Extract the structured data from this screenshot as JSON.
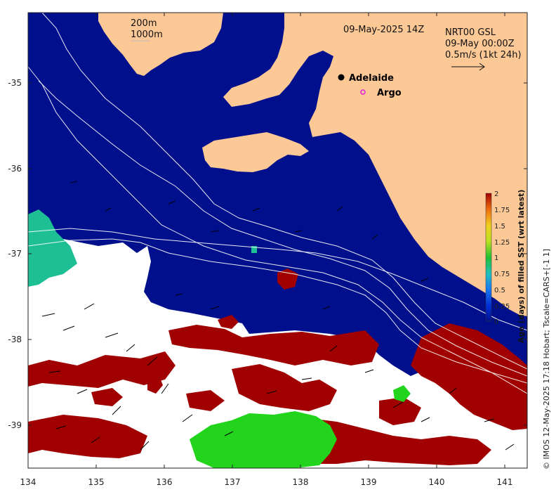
{
  "map": {
    "timestamp": "09-May-2025 14Z",
    "product": "NRT00 GSL",
    "product_time": "09-May 00:00Z",
    "vector_scale": "0.5m/s (1kt 24h)",
    "isobath_1": "200m",
    "isobath_2": "1000m",
    "credit": "© IMOS 12-May-2025 17:18 Hobart; Tscale=CARS+[-1 1]",
    "places": [
      {
        "name": "Adelaide",
        "marker": "filled-dot"
      },
      {
        "name": "Argo",
        "marker": "magenta-ring"
      }
    ],
    "colors": {
      "ocean_fresh": "#00108c",
      "land": "#fcc896",
      "stale_red": "#a00000",
      "green": "#22d41c",
      "teal": "#1fbf96",
      "no_data": "#ffffff"
    },
    "x_ticks": [
      "134",
      "135",
      "136",
      "137",
      "138",
      "139",
      "140",
      "141"
    ],
    "y_ticks": [
      "-35",
      "-36",
      "-37",
      "-38",
      "-39"
    ]
  },
  "colorbar": {
    "title": "Age (days) of filled SST (wrt latest)",
    "ticks": [
      "2",
      "1.75",
      "1.5",
      "1.25",
      "1",
      "0.75",
      "0.5",
      "0.25",
      "0"
    ],
    "range": [
      0,
      2
    ]
  }
}
